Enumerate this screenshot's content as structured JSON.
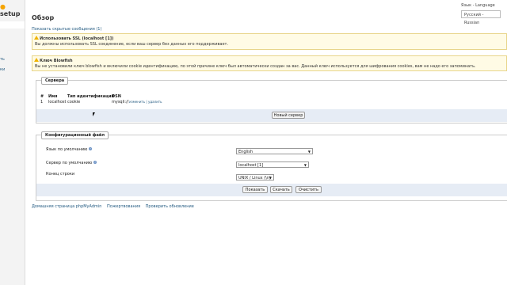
{
  "sidebar": {
    "logo_text": "setup",
    "nav_items": [
      "ть",
      "ки"
    ]
  },
  "header": {
    "title": "Обзор",
    "show_hidden": "Показать скрытые сообщения (1)",
    "language_label": "Язык - Language",
    "language_value": "Русский - Russian"
  },
  "notices": [
    {
      "head": "Использовать SSL (localhost [1])",
      "text": "Вы должны использовать SSL соединение, если ваш сервер без данных его поддерживает."
    },
    {
      "head": "Ключ Blowfish",
      "text": "Вы не установили ключ blowfish и включили cookie идентификацию, по этой причине ключ был автоматически создан за вас. Данный ключ используется для шифрования cookies, вам не надо его запоминать."
    }
  ],
  "servers": {
    "legend": "Сервера",
    "columns": [
      "#",
      "Имя",
      "Тип идентификации",
      "DSN"
    ],
    "rows": [
      {
        "num": "1",
        "name": "localhost",
        "auth": "cookie",
        "dsn": "mysqli://",
        "actions": "изменить | удалить"
      }
    ],
    "new_server_button": "Новый сервер"
  },
  "config": {
    "legend": "Конфигурационный файл",
    "default_language_label": "Язык по умолчанию",
    "default_language_value": "English",
    "default_server_label": "Сервер по умолчанию",
    "default_server_value": "localhost [1]",
    "eol_label": "Конец строки",
    "eol_value": "UNIX / Linux (\\n)",
    "display_button": "Показать",
    "download_button": "Скачать",
    "clear_button": "Очистить"
  },
  "footer": {
    "links": [
      "Домашняя страница phpMyAdmin",
      "Пожертвования",
      "Проверить обновление"
    ]
  },
  "colors": {
    "link": "#235a81",
    "notice_bg": "#fffbe5",
    "band": "#e6ecf5"
  }
}
